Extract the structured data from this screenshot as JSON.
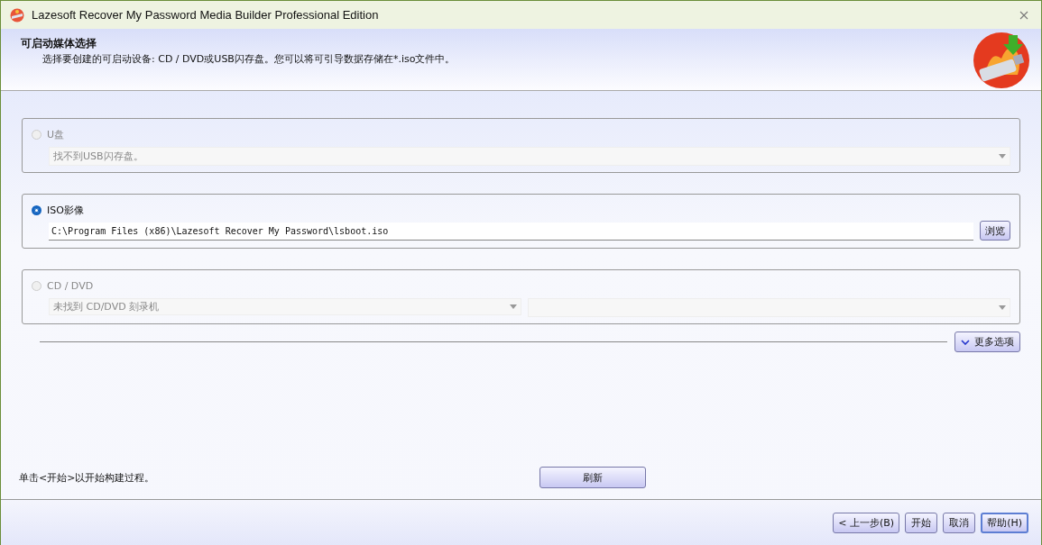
{
  "window": {
    "title": "Lazesoft Recover My Password Media Builder Professional Edition"
  },
  "header": {
    "title": "可启动媒体选择",
    "description": "选择要创建的可启动设备: CD / DVD或USB闪存盘。您可以将可引导数据存储在*.iso文件中。"
  },
  "options": [
    {
      "label": "U盘",
      "selected": false,
      "disabled": true,
      "kind": "combo",
      "value": "找不到USB闪存盘。"
    },
    {
      "label": "ISO影像",
      "selected": true,
      "disabled": false,
      "kind": "path",
      "value": "C:\\Program Files (x86)\\Lazesoft Recover My Password\\lsboot.iso",
      "button": "浏览"
    },
    {
      "label": "CD / DVD",
      "selected": false,
      "disabled": true,
      "kind": "combo_pair",
      "value": "未找到 CD/DVD 刻录机"
    }
  ],
  "more_options": {
    "label": "更多选项"
  },
  "hint": "单击<开始>以开始构建过程。",
  "refresh_button": "刷新",
  "footer_buttons": [
    {
      "label": "< 上一步(B)",
      "default": false
    },
    {
      "label": "开始",
      "default": false
    },
    {
      "label": "取消",
      "default": false
    },
    {
      "label": "帮助(H)",
      "default": true
    }
  ]
}
